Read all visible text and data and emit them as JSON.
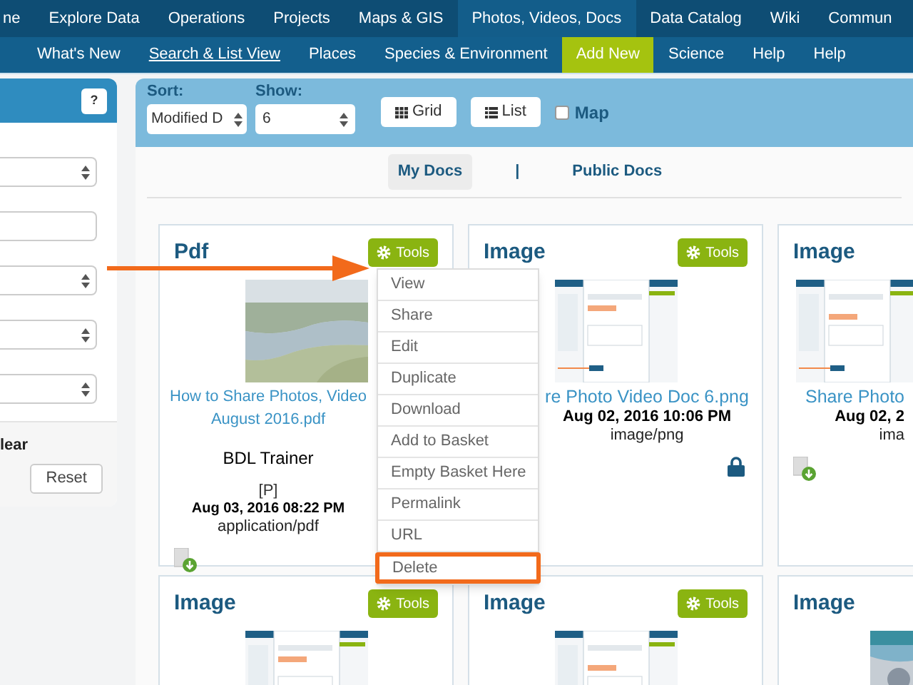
{
  "top_nav": [
    {
      "label": "ne",
      "selected": false
    },
    {
      "label": "Explore Data",
      "selected": false
    },
    {
      "label": "Operations",
      "selected": false
    },
    {
      "label": "Projects",
      "selected": false
    },
    {
      "label": "Maps & GIS",
      "selected": false
    },
    {
      "label": "Photos, Videos, Docs",
      "selected": true
    },
    {
      "label": "Data Catalog",
      "selected": false
    },
    {
      "label": "Wiki",
      "selected": false
    },
    {
      "label": "Commun",
      "selected": false
    }
  ],
  "sub_nav": [
    {
      "label": "What's New",
      "selected": false,
      "underlined": false
    },
    {
      "label": "Search & List View",
      "selected": false,
      "underlined": true
    },
    {
      "label": "Places",
      "selected": false,
      "underlined": false
    },
    {
      "label": "Species & Environment",
      "selected": false,
      "underlined": false
    },
    {
      "label": "Add New",
      "selected": true,
      "underlined": false
    },
    {
      "label": "Science",
      "selected": false,
      "underlined": false
    },
    {
      "label": "Help",
      "selected": false,
      "underlined": false
    },
    {
      "label": "Help",
      "selected": false,
      "underlined": false
    }
  ],
  "filter_panel": {
    "help": "?",
    "fields": [
      {
        "kind": "select"
      },
      {
        "kind": "input"
      },
      {
        "kind": "select"
      },
      {
        "kind": "select"
      },
      {
        "kind": "select"
      }
    ],
    "clear_label": "lear",
    "reset": "Reset"
  },
  "toolbar": {
    "sort": {
      "label": "Sort:",
      "value": "Modified D"
    },
    "show": {
      "label": "Show:",
      "value": "6"
    },
    "view_buttons": [
      {
        "kind": "grid",
        "label": "Grid"
      },
      {
        "kind": "list",
        "label": "List"
      }
    ],
    "map": {
      "label": "Map",
      "checked": false
    }
  },
  "doc_tabs": [
    {
      "label": "My Docs",
      "selected": true
    },
    {
      "label": "Public Docs",
      "selected": false
    }
  ],
  "doc_tabs_separator": "|",
  "cards": [
    {
      "title": "Pdf",
      "tools": "Tools",
      "name": "How to Share Photos, Video August 2016.pdf",
      "author": "BDL Trainer",
      "flag": "[P]",
      "date": "Aug 03, 2016 08:22 PM",
      "type": "application/pdf",
      "badge": {
        "kind": "download"
      }
    },
    {
      "title": "Image",
      "tools": "Tools",
      "thumbnail": {
        "kind": "screenshot"
      },
      "name": "re Photo Video Doc 6.png",
      "date": "Aug 02, 2016 10:06 PM",
      "type": "image/png",
      "badge": {
        "kind": "lock"
      }
    },
    {
      "title": "Image",
      "thumbnail": {
        "kind": "screenshot"
      },
      "name": "Share Photo",
      "date": "Aug 02, 2",
      "type": "ima",
      "badge": {
        "kind": "download"
      }
    },
    {
      "title": "Image",
      "tools": "Tools",
      "thumbnail": {
        "kind": "screenshot"
      }
    },
    {
      "title": "Image",
      "tools": "Tools",
      "thumbnail": {
        "kind": "screenshot"
      }
    },
    {
      "title": "Image",
      "thumbnail": {
        "kind": "map"
      }
    }
  ],
  "tools_menu": [
    {
      "label": "View",
      "highlighted": false
    },
    {
      "label": "Share",
      "highlighted": false
    },
    {
      "label": "Edit",
      "highlighted": false
    },
    {
      "label": "Duplicate",
      "highlighted": false
    },
    {
      "label": "Download",
      "highlighted": false
    },
    {
      "label": "Add to Basket",
      "highlighted": false
    },
    {
      "label": "Empty Basket Here",
      "highlighted": false
    },
    {
      "label": "Permalink",
      "highlighted": false
    },
    {
      "label": "URL",
      "highlighted": false
    },
    {
      "label": "Delete",
      "highlighted": true
    }
  ]
}
